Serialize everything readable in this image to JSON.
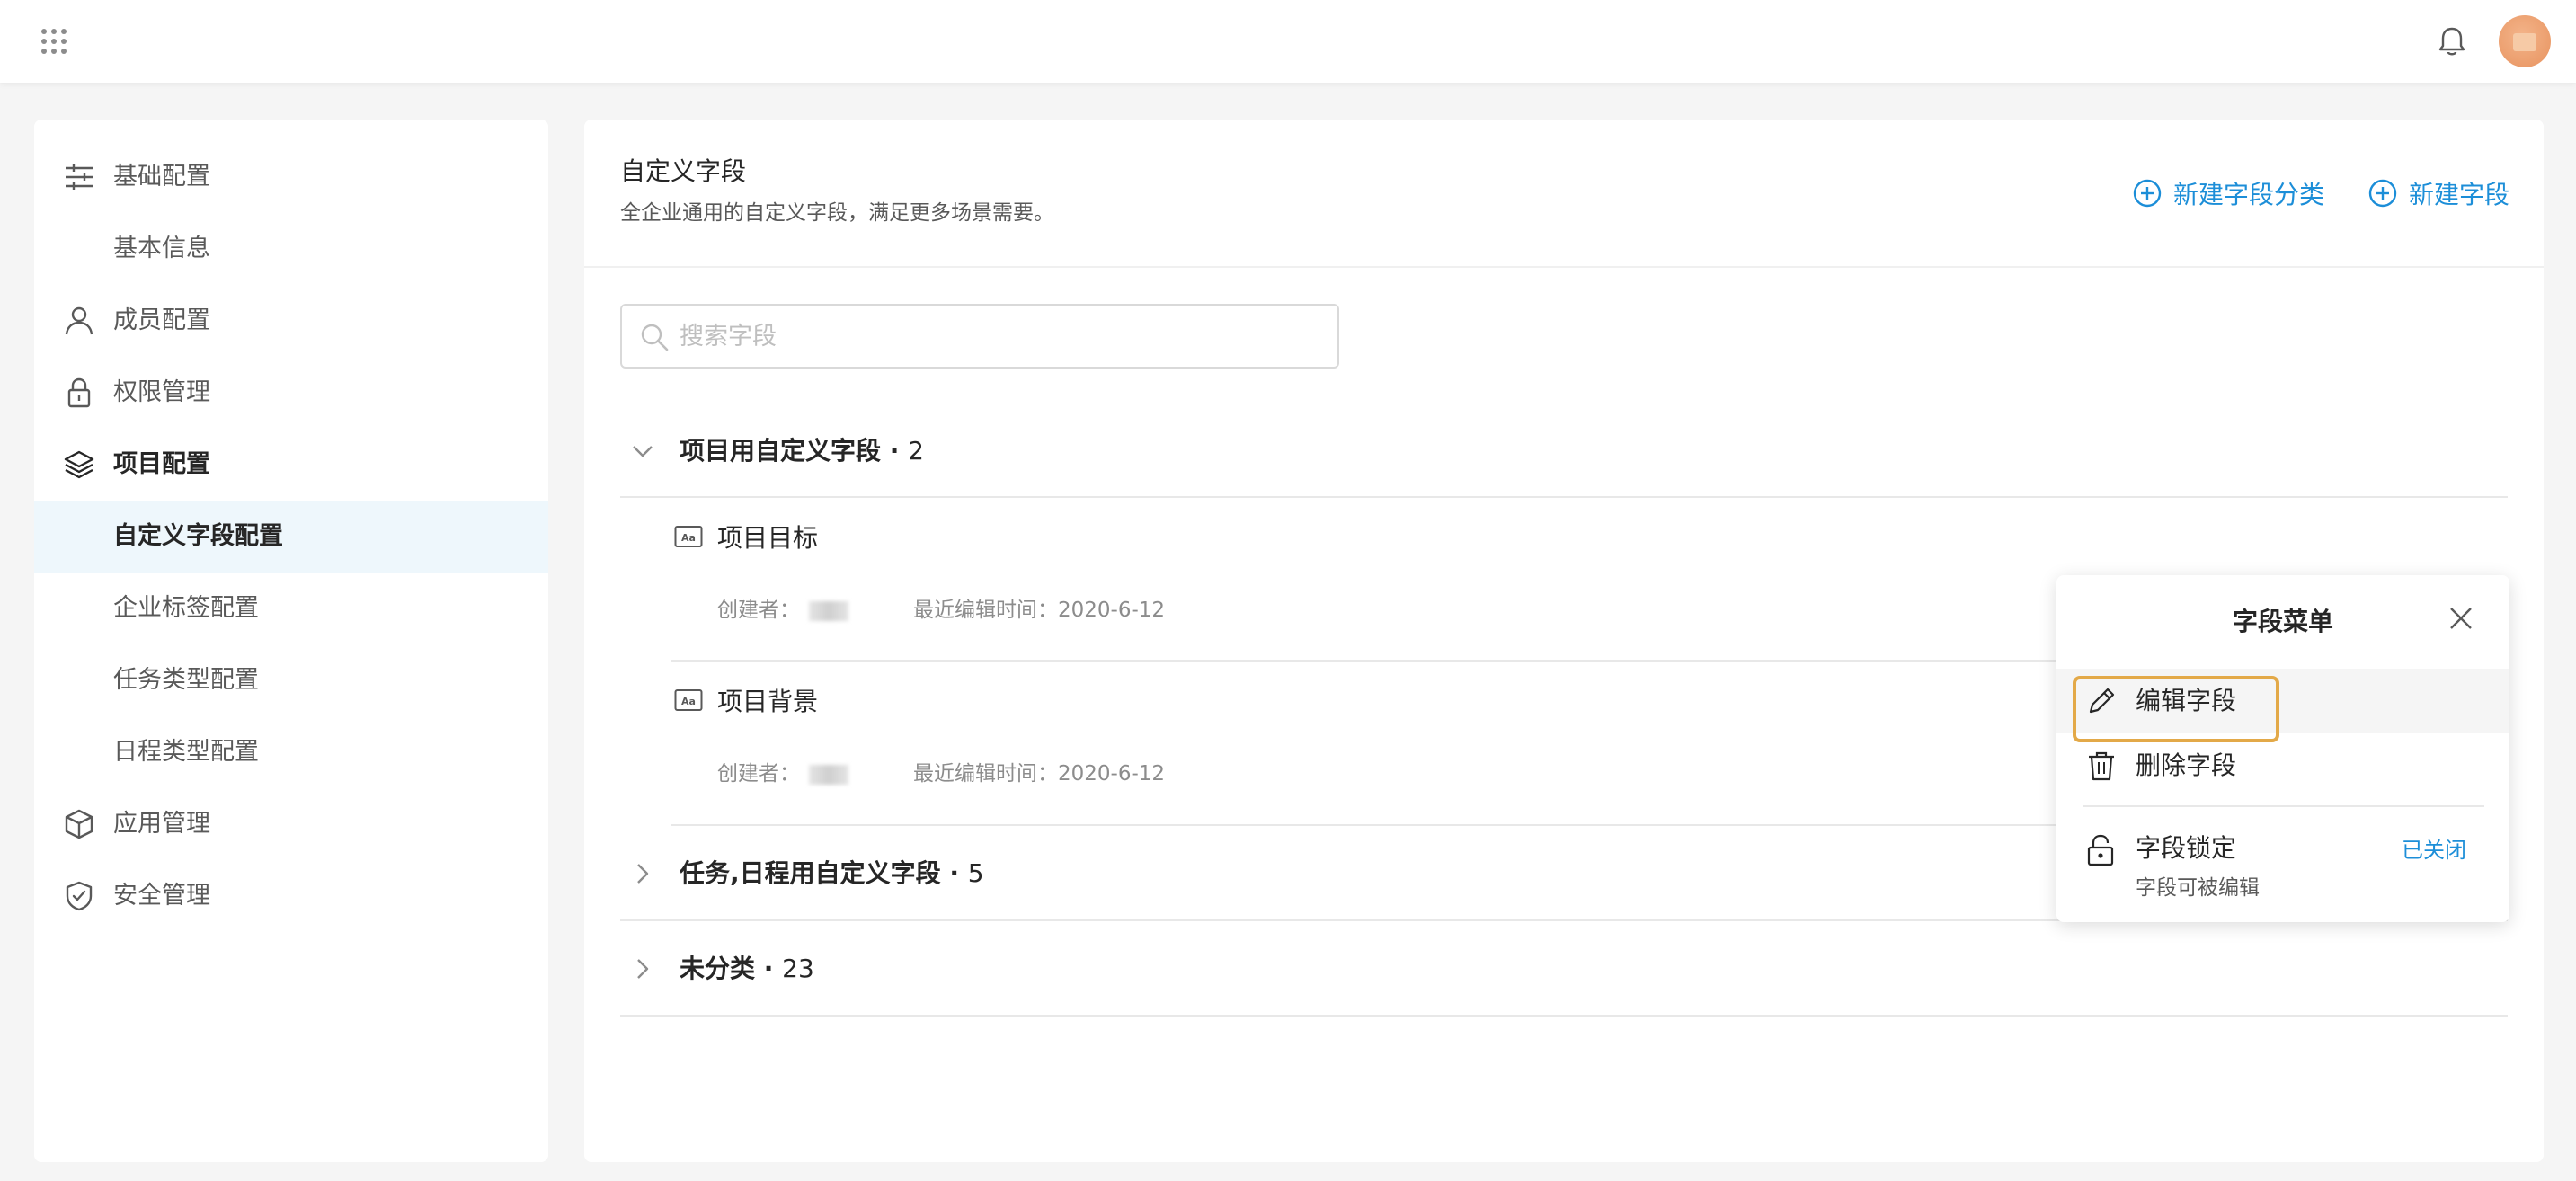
{
  "sidebar": {
    "items": [
      {
        "label": "基础配置"
      },
      {
        "label": "基本信息"
      },
      {
        "label": "成员配置"
      },
      {
        "label": "权限管理"
      },
      {
        "label": "项目配置"
      },
      {
        "label": "自定义字段配置"
      },
      {
        "label": "企业标签配置"
      },
      {
        "label": "任务类型配置"
      },
      {
        "label": "日程类型配置"
      },
      {
        "label": "应用管理"
      },
      {
        "label": "安全管理"
      }
    ]
  },
  "main": {
    "title": "自定义字段",
    "description": "全企业通用的自定义字段，满足更多场景需要。",
    "new_category_label": "新建字段分类",
    "new_field_label": "新建字段",
    "search_placeholder": "搜索字段",
    "groups": [
      {
        "title": "项目用自定义字段 · ",
        "count": "2",
        "expanded": true
      },
      {
        "title": "任务,日程用自定义字段 · ",
        "count": "5",
        "expanded": false
      },
      {
        "title": "未分类 · ",
        "count": "23",
        "expanded": false
      }
    ],
    "fields": [
      {
        "name": "项目目标",
        "creator_label": "创建者：",
        "edited": "最近编辑时间：2020-6-12"
      },
      {
        "name": "项目背景",
        "creator_label": "创建者：",
        "edited": "最近编辑时间：2020-6-12"
      }
    ]
  },
  "popup": {
    "title": "字段菜单",
    "edit_label": "编辑字段",
    "delete_label": "删除字段",
    "lock_title": "字段锁定",
    "lock_subtitle": "字段可被编辑",
    "lock_status": "已关闭"
  },
  "colors": {
    "accent": "#1c8ed8",
    "highlight": "#e3a948",
    "active_bg": "#eef7fc"
  }
}
